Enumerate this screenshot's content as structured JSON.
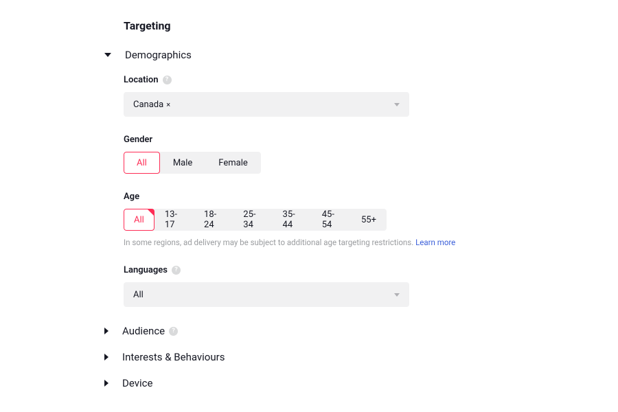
{
  "page_title": "Targeting",
  "sections": {
    "demographics": {
      "label": "Demographics",
      "expanded": true
    },
    "audience": {
      "label": "Audience",
      "expanded": false
    },
    "interests": {
      "label": "Interests & Behaviours",
      "expanded": false
    },
    "device": {
      "label": "Device",
      "expanded": false
    }
  },
  "location": {
    "label": "Location",
    "selected": "Canada",
    "close_glyph": "×"
  },
  "gender": {
    "label": "Gender",
    "options": [
      "All",
      "Male",
      "Female"
    ],
    "selected_index": 0
  },
  "age": {
    "label": "Age",
    "options": [
      "All",
      "13-17",
      "18-24",
      "25-34",
      "35-44",
      "45-54",
      "55+"
    ],
    "selected_index": 0,
    "note_text": "In some regions, ad delivery may be subject to additional age targeting restrictions. ",
    "learn_more": "Learn more"
  },
  "languages": {
    "label": "Languages",
    "selected": "All"
  },
  "help_glyph": "?"
}
